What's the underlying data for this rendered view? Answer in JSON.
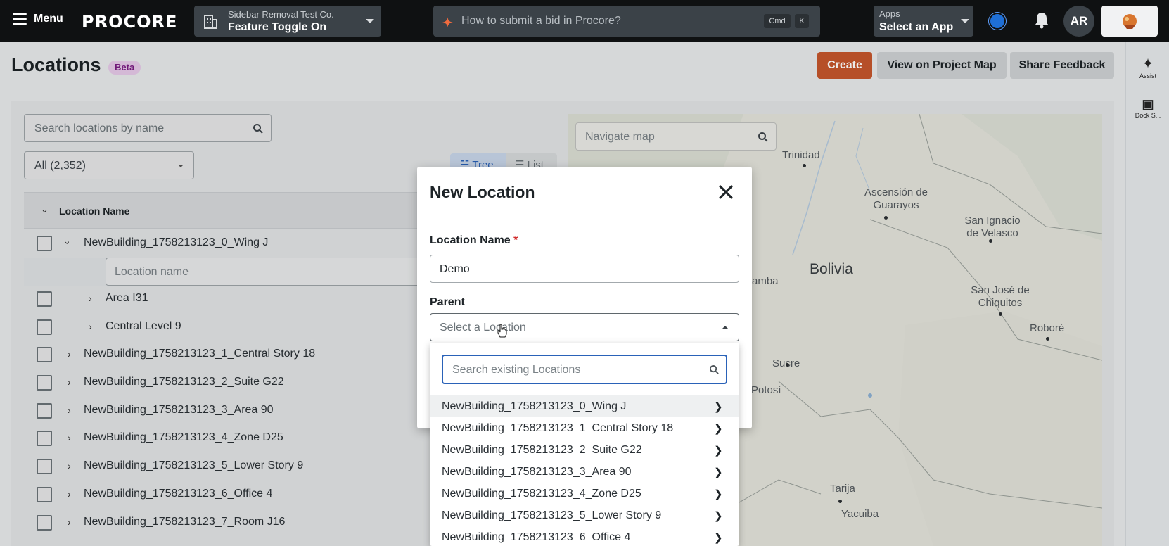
{
  "topbar": {
    "menu_label": "Menu",
    "logo_text": "PROCORE",
    "company": {
      "sub": "Sidebar Removal Test Co.",
      "main": "Feature Toggle On"
    },
    "search_placeholder": "How to submit a bid in Procore?",
    "kbd_cmd": "Cmd",
    "kbd_k": "K",
    "apps": {
      "sub": "Apps",
      "main": "Select an App"
    },
    "avatar_initials": "AR"
  },
  "rail": {
    "assist_label": "Assist",
    "dock_label": "Dock S..."
  },
  "header": {
    "title": "Locations",
    "badge": "Beta",
    "create_label": "Create",
    "map_label": "View on Project Map",
    "feedback_label": "Share Feedback"
  },
  "list": {
    "search_placeholder": "Search locations by name",
    "filter_value": "All (2,352)",
    "tree_label": "Tree",
    "list_label": "List",
    "column_header": "Location Name",
    "inline_placeholder": "Location name",
    "rows": [
      {
        "name": "NewBuilding_1758213123_0_Wing J"
      },
      {
        "name": "Area I31"
      },
      {
        "name": "Central Level 9"
      },
      {
        "name": "NewBuilding_1758213123_1_Central Story 18"
      },
      {
        "name": "NewBuilding_1758213123_2_Suite G22"
      },
      {
        "name": "NewBuilding_1758213123_3_Area 90"
      },
      {
        "name": "NewBuilding_1758213123_4_Zone D25"
      },
      {
        "name": "NewBuilding_1758213123_5_Lower Story 9"
      },
      {
        "name": "NewBuilding_1758213123_6_Office 4"
      },
      {
        "name": "NewBuilding_1758213123_7_Room J16"
      }
    ]
  },
  "map": {
    "search_placeholder": "Navigate map",
    "country": "Bolivia",
    "cities": [
      "Trinidad",
      "Ascensión de Guarayos",
      "San Ignacio de Velasco",
      "amba",
      "San José de Chiquitos",
      "Roboré",
      "Sucre",
      "Potosí",
      "Tarija",
      "Yacuiba"
    ]
  },
  "modal": {
    "title": "New Location",
    "name_label": "Location Name",
    "required_mark": "*",
    "name_value": "Demo",
    "parent_label": "Parent",
    "parent_placeholder": "Select a Location",
    "dropdown_search_placeholder": "Search existing Locations",
    "options": [
      "NewBuilding_1758213123_0_Wing J",
      "NewBuilding_1758213123_1_Central Story 18",
      "NewBuilding_1758213123_2_Suite G22",
      "NewBuilding_1758213123_3_Area 90",
      "NewBuilding_1758213123_4_Zone D25",
      "NewBuilding_1758213123_5_Lower Story 9",
      "NewBuilding_1758213123_6_Office 4"
    ]
  },
  "colors": {
    "brand_orange": "#c6562c",
    "focus_blue": "#2a62b8",
    "topbar": "#0f1112"
  }
}
